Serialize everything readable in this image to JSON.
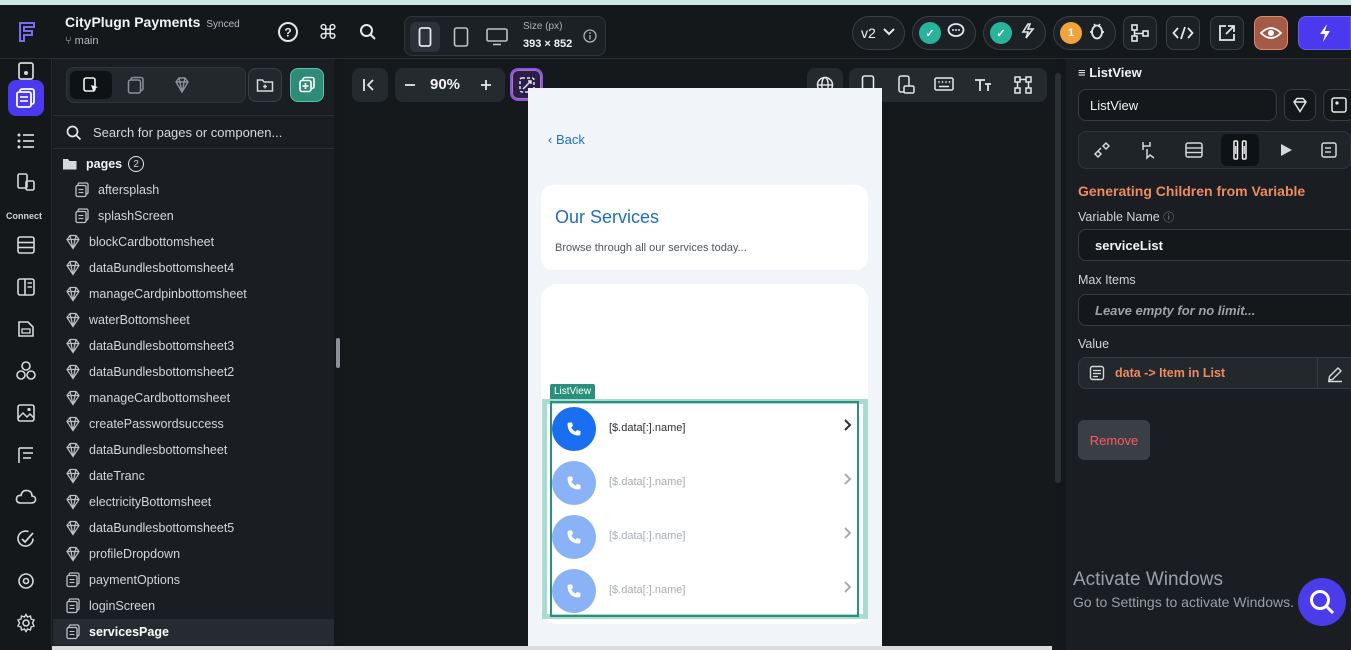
{
  "app": {
    "project_title": "CityPlugn Payments",
    "sync_status": "Synced",
    "branch": "main"
  },
  "toolbar": {
    "help_icon": "help-circle-icon",
    "command_icon": "command-icon",
    "search_icon": "search-icon",
    "device_size_label": "Size (px)",
    "device_size_value": "393 × 852",
    "version_label": "v2",
    "warning_count": "1",
    "accent_color": "#4b39ef"
  },
  "left_rail": {
    "connect_label": "Connect"
  },
  "navigator": {
    "search_placeholder": "Search for pages or componen...",
    "folder_label": "pages",
    "folder_count": "2",
    "items": [
      {
        "label": "aftersplash",
        "icon": "page-icon",
        "indent": true
      },
      {
        "label": "splashScreen",
        "icon": "page-icon",
        "indent": true
      },
      {
        "label": "blockCardbottomsheet",
        "icon": "component-icon"
      },
      {
        "label": "dataBundlesbottomsheet4",
        "icon": "component-icon"
      },
      {
        "label": "manageCardpinbottomsheet",
        "icon": "component-icon"
      },
      {
        "label": "waterBottomsheet",
        "icon": "component-icon"
      },
      {
        "label": "dataBundlesbottomsheet3",
        "icon": "component-icon"
      },
      {
        "label": "dataBundlesbottomsheet2",
        "icon": "component-icon"
      },
      {
        "label": "manageCardbottomsheet",
        "icon": "component-icon"
      },
      {
        "label": "createPasswordsuccess",
        "icon": "component-icon"
      },
      {
        "label": "dataBundlesbottomsheet",
        "icon": "component-icon"
      },
      {
        "label": "dateTranc",
        "icon": "component-icon"
      },
      {
        "label": "electricityBottomsheet",
        "icon": "component-icon"
      },
      {
        "label": "dataBundlesbottomsheet5",
        "icon": "component-icon"
      },
      {
        "label": "profileDropdown",
        "icon": "component-icon"
      },
      {
        "label": "paymentOptions",
        "icon": "page-icon"
      },
      {
        "label": "loginScreen",
        "icon": "page-icon"
      },
      {
        "label": "servicesPage",
        "icon": "page-icon",
        "selected": true
      }
    ]
  },
  "canvas": {
    "zoom": "90%",
    "phone": {
      "back_label": "Back",
      "services_title": "Our Services",
      "services_subtitle": "Browse through all our services today...",
      "listview_tag": "ListView",
      "list_rows": [
        {
          "name": "[$.data[:].name]",
          "active": true
        },
        {
          "name": "[$.data[:].name]",
          "active": false
        },
        {
          "name": "[$.data[:].name]",
          "active": false
        },
        {
          "name": "[$.data[:].name]",
          "active": false
        }
      ],
      "primary_color": "#1a6ff0",
      "muted_color": "#8ab3f7"
    }
  },
  "properties": {
    "header": "ListView",
    "widget_name_value": "ListView",
    "section_title": "Generating Children from Variable",
    "variable_name_label": "Variable Name",
    "variable_name_value": "serviceList",
    "max_items_label": "Max Items",
    "max_items_placeholder": "Leave empty for no limit...",
    "value_label": "Value",
    "value_value": "data -> Item in List",
    "remove_label": "Remove",
    "orange_color": "#ee8b60"
  },
  "overlay": {
    "activate_title": "Activate Windows",
    "activate_sub": "Go to Settings to activate Windows."
  }
}
